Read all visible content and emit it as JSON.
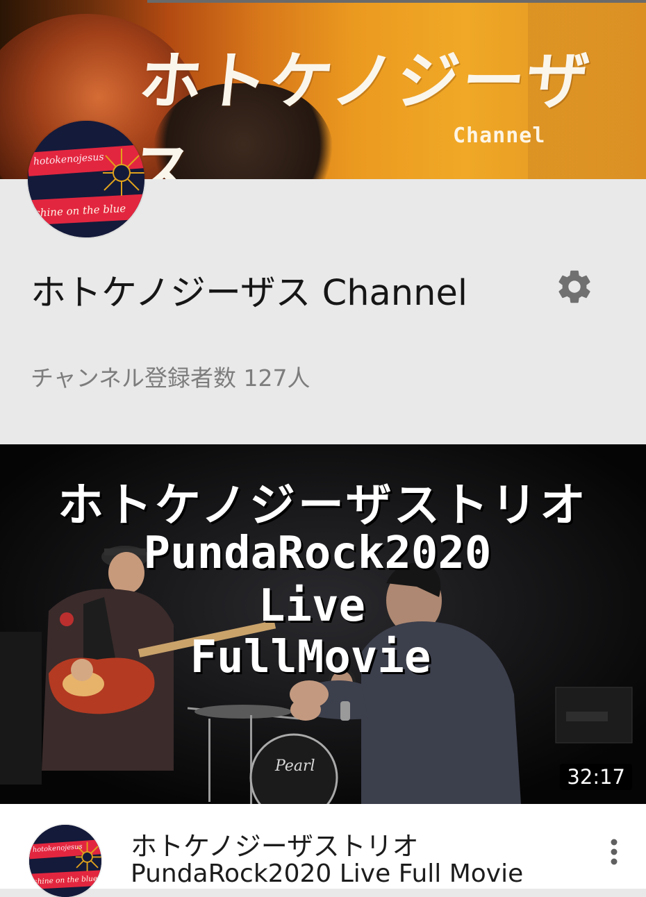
{
  "banner": {
    "title": "ホトケノジーザス",
    "subtitle": "Channel"
  },
  "avatar": {
    "text_top": "hotokenojesus",
    "text_bottom": "shine on the blue",
    "colors": {
      "navy": "#141a3a",
      "red": "#e3263f",
      "gold": "#e0a21c"
    }
  },
  "channel": {
    "name": "ホトケノジーザス Channel",
    "subscribers": "チャンネル登録者数 127人",
    "settings_icon": "gear-icon"
  },
  "video": {
    "thumbnail_text": {
      "line1": "ホトケノジーザストリオ",
      "line2": "PundaRock2020",
      "line3": "Live",
      "line4": "FullMovie"
    },
    "duration": "32:17",
    "title_line1": "ホトケノジーザストリオ",
    "title_line2": "PundaRock2020 Live Full Movie",
    "menu_icon": "more-vert-icon",
    "drum_brand": "Pearl"
  }
}
